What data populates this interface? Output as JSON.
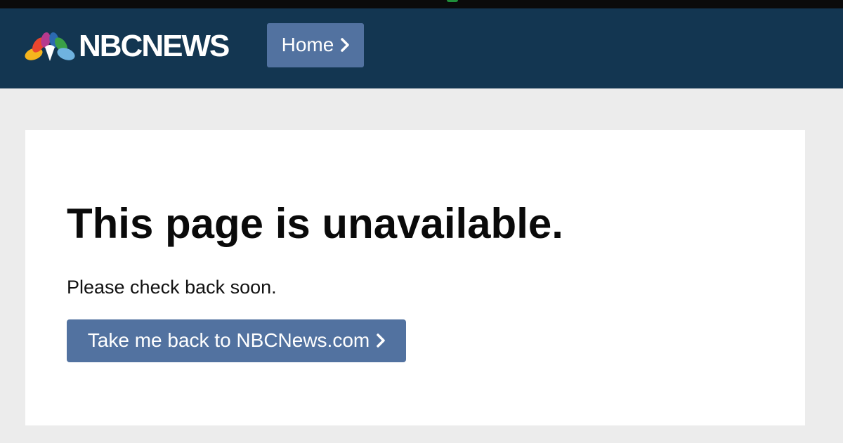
{
  "header": {
    "logo_text": "NBCNEWS",
    "home_label": "Home"
  },
  "main": {
    "title": "This page is unavailable.",
    "message": "Please check back soon.",
    "back_label": "Take me back to NBCNews.com"
  },
  "colors": {
    "header_bg": "#133651",
    "button_bg": "#5272a0",
    "page_bg": "#ececec",
    "panel_bg": "#ffffff"
  },
  "icons": {
    "logo": "nbc-peacock-icon",
    "home_chevron": "chevron-right-icon",
    "back_chevron": "chevron-right-icon"
  }
}
